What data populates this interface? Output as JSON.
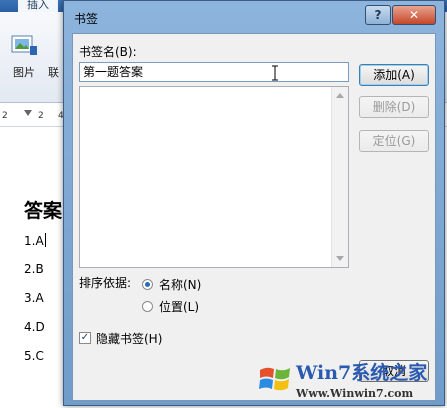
{
  "background_app": {
    "ribbon": {
      "active_tab": "插入",
      "groups": [
        {
          "label": "图片"
        },
        {
          "label": "联"
        }
      ]
    },
    "ruler": {
      "ticks": [
        "2",
        "2",
        "4"
      ]
    },
    "document": {
      "heading": "答案",
      "lines": [
        "1.A",
        "2.B",
        "3.A",
        "4.D",
        "5.C"
      ]
    }
  },
  "dialog": {
    "title": "书签",
    "help_label": "?",
    "close_label": "✕",
    "name_label": "书签名(B):",
    "name_value": "第一题答案",
    "list_items": [],
    "buttons": {
      "add": "添加(A)",
      "delete": "删除(D)",
      "goto": "定位(G)",
      "cancel": "取消"
    },
    "sort_label": "排序依据:",
    "sort_options": {
      "by_name": "名称(N)",
      "by_location": "位置(L)"
    },
    "sort_selected": "by_name",
    "hidden_bookmarks": {
      "label": "隐藏书签(H)",
      "checked": true
    }
  },
  "watermark": {
    "title": "Win7系统之家",
    "url": "Www.Winwin7.com"
  },
  "colors": {
    "dialog_frame": "#6f9cc9",
    "ribbon_top": "#2a5fa3",
    "watermark_text": "#2a59b0"
  }
}
